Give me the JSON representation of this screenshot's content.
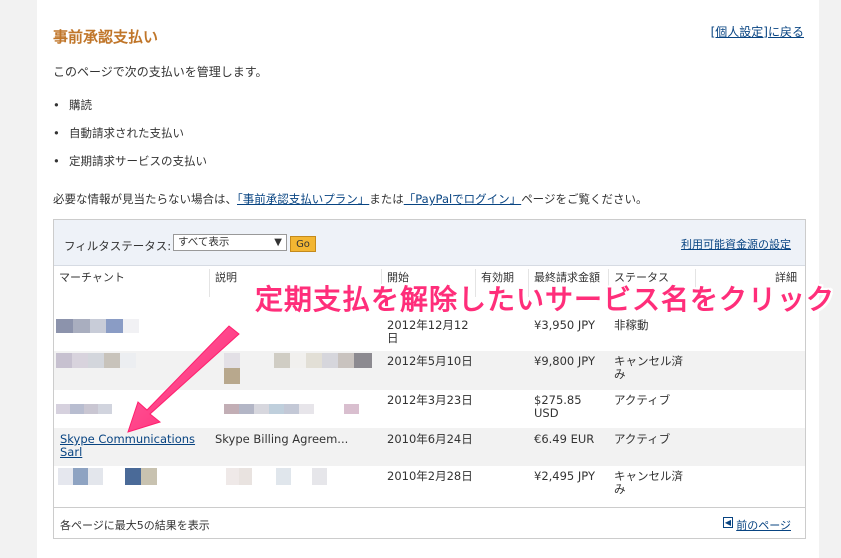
{
  "page": {
    "title": "事前承認支払い",
    "back_link": "[個人設定]に戻る",
    "intro": "このページで次の支払いを管理します。",
    "bullets": [
      "購読",
      "自動請求された支払い",
      "定期請求サービスの支払い"
    ],
    "notice_prefix": "必要な情報が見当たらない場合は、",
    "notice_link1": "「事前承認支払いプラン」",
    "notice_mid": "または",
    "notice_link2": "「PayPalでログイン」",
    "notice_suffix": "ページをご覧ください。"
  },
  "filter": {
    "label": "フィルタステータス:",
    "selected": "すべて表示",
    "go": "Go",
    "funding_link": "利用可能資金源の設定"
  },
  "table": {
    "headers": {
      "merchant": "マーチャント",
      "description": "説明",
      "start": "開始",
      "expiry": "有効期",
      "last_amount": "最終請求金額",
      "status": "ステータス",
      "detail": "詳細"
    },
    "rows": [
      {
        "merchant": "",
        "description": "",
        "start": "2012年12月12日",
        "amount": "¥3,950 JPY",
        "status": "非稼動"
      },
      {
        "merchant": "",
        "description": "",
        "start": "2012年5月10日",
        "amount": "¥9,800 JPY",
        "status": "キャンセル済み"
      },
      {
        "merchant": "",
        "description": "",
        "start": "2012年3月23日",
        "amount": "$275.85 USD",
        "status": "アクティブ"
      },
      {
        "merchant": "Skype Communications Sarl",
        "description": "Skype Billing Agreem...",
        "start": "2010年6月24日",
        "amount": "€6.49 EUR",
        "status": "アクティブ"
      },
      {
        "merchant": "",
        "description": "",
        "start": "2010年2月28日",
        "amount": "¥2,495 JPY",
        "status": "キャンセル済み"
      }
    ]
  },
  "footer": {
    "results_text": "各ページに最大5の結果を表示",
    "prev_link": "前のページ"
  },
  "annotation": {
    "text": "定期支払を解除したいサービス名をクリック",
    "color": "#ff2e7a"
  }
}
